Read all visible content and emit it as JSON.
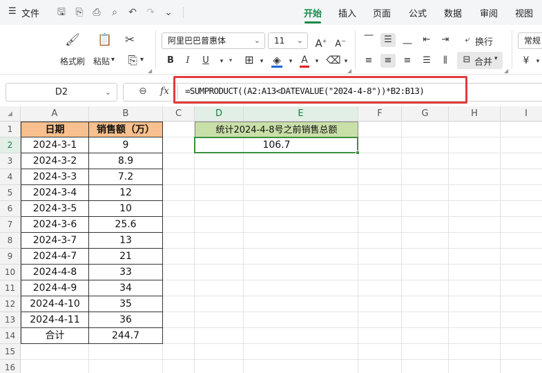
{
  "menubar": {
    "hamburger": "☰",
    "file": "文件",
    "tabs": [
      "开始",
      "插入",
      "页面",
      "公式",
      "数据",
      "审阅",
      "视图"
    ],
    "active_tab": "开始"
  },
  "ribbon": {
    "format_painter": "格式刷",
    "paste": "粘贴",
    "font_name": "阿里巴巴普惠体",
    "font_size": "11",
    "wrap": "换行",
    "merge": "合并",
    "number_format": "常规",
    "bold": "B",
    "italic": "I",
    "underline": "U",
    "font_color": "A",
    "grow": "A",
    "shrink": "A",
    "currency": "¥"
  },
  "formula_bar": {
    "name_box": "D2",
    "fx": "fx",
    "formula": "=SUMPRODUCT((A2:A13<DATEVALUE(\"2024-4-8\"))*B2:B13)"
  },
  "columns": [
    "A",
    "B",
    "C",
    "D",
    "E",
    "F",
    "G",
    "H",
    "I"
  ],
  "rows": [
    "1",
    "2",
    "3",
    "4",
    "5",
    "6",
    "7",
    "8",
    "9",
    "10",
    "11",
    "12",
    "13",
    "14",
    "15",
    "16"
  ],
  "table": {
    "header_date": "日期",
    "header_sales": "销售额（万）",
    "records": [
      {
        "date": "2024-3-1",
        "sales": "9"
      },
      {
        "date": "2024-3-2",
        "sales": "8.9"
      },
      {
        "date": "2024-3-3",
        "sales": "7.2"
      },
      {
        "date": "2024-3-4",
        "sales": "12"
      },
      {
        "date": "2024-3-5",
        "sales": "10"
      },
      {
        "date": "2024-3-6",
        "sales": "25.6"
      },
      {
        "date": "2024-3-7",
        "sales": "13"
      },
      {
        "date": "2024-4-7",
        "sales": "21"
      },
      {
        "date": "2024-4-8",
        "sales": "33"
      },
      {
        "date": "2024-4-9",
        "sales": "34"
      },
      {
        "date": "2024-4-10",
        "sales": "35"
      },
      {
        "date": "2024-4-11",
        "sales": "36"
      }
    ],
    "total_label": "合计",
    "total_value": "244.7"
  },
  "summary": {
    "title": "统计2024-4-8号之前销售总额",
    "value": "106.7"
  },
  "colors": {
    "accent": "#1a8a4a",
    "header_fill": "#f8c08e",
    "summary_fill": "#c9dfa8",
    "highlight_box": "#e23b3b"
  }
}
